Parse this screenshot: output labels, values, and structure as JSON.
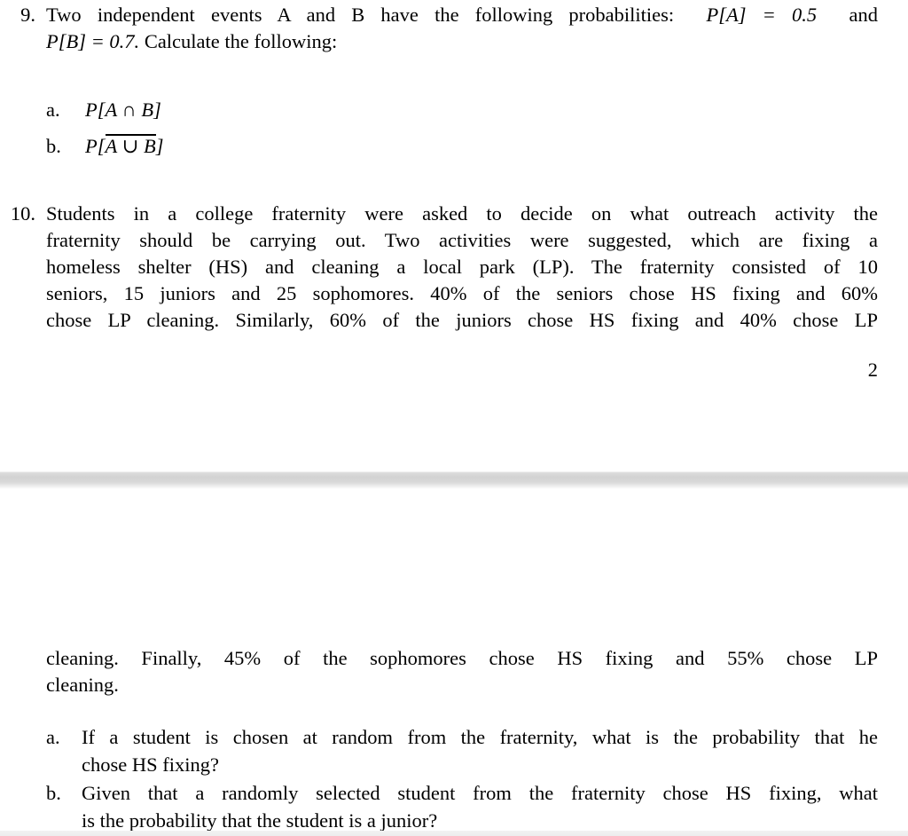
{
  "document": {
    "type": "probability-homework-scan",
    "page_number": "2"
  },
  "page_top": {
    "problem9": {
      "marker": "9.",
      "line1": "Two independent events A and B have the following probabilities:",
      "line1_math": "P[A] = 0.5",
      "line1_tail": "and",
      "line2_math": "P[B] = 0.7.",
      "line2_tail": "Calculate the following:",
      "items": [
        {
          "marker": "a.",
          "prefix": "P[",
          "expr": "A ∩ B",
          "suffix": "]",
          "overline": false
        },
        {
          "marker": "b.",
          "prefix": "P[",
          "expr": "A ∪ B",
          "suffix": "]",
          "overline": true
        }
      ]
    },
    "problem10": {
      "marker": "10.",
      "lines": [
        "Students in a college fraternity were asked to decide on what outreach activity the",
        "fraternity should be carrying out. Two activities were suggested, which are fixing a",
        "homeless shelter (HS) and cleaning a local park (LP). The fraternity consisted of 10",
        "seniors, 15 juniors and 25 sophomores. 40% of the seniors chose HS fixing and 60%",
        "chose LP cleaning. Similarly, 60% of the juniors chose HS fixing and 40% chose LP"
      ]
    },
    "page_number": "2"
  },
  "page_bottom": {
    "continuation": {
      "lines": [
        "cleaning. Finally, 45% of the sophomores chose HS fixing and 55% chose LP",
        "cleaning."
      ]
    },
    "questions": [
      {
        "marker": "a.",
        "lines": [
          "If a student is chosen at random from the fraternity, what is the probability that he",
          "chose HS fixing?"
        ]
      },
      {
        "marker": "b.",
        "lines": [
          "Given that a randomly selected student from the fraternity chose HS fixing, what",
          "is the probability that the student is a junior?"
        ]
      }
    ]
  },
  "colors": {
    "text": "#000000",
    "background": "#ffffff",
    "separator_gray": "#d2d2d2"
  }
}
